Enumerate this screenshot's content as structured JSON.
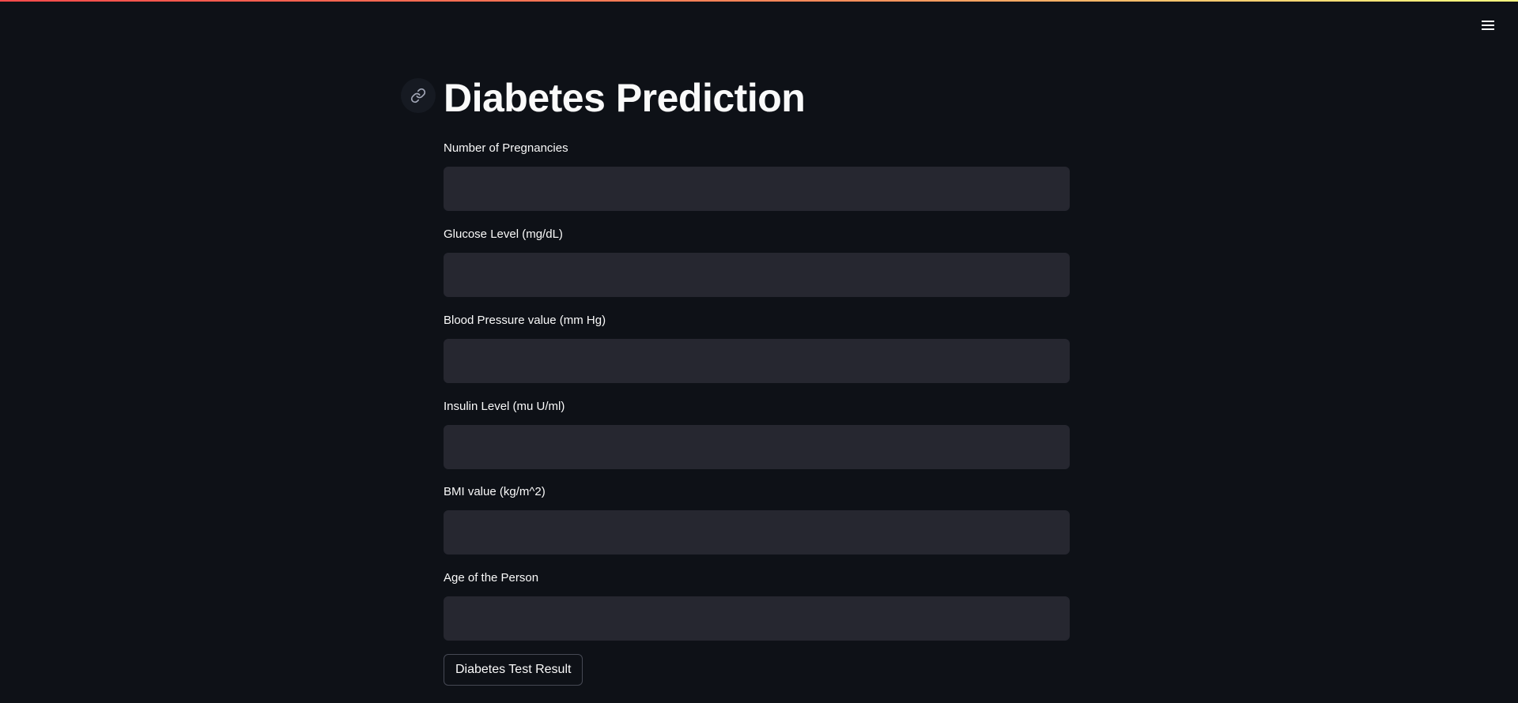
{
  "header": {
    "menu_icon": "hamburger-menu-icon"
  },
  "main": {
    "title": "Diabetes Prediction",
    "anchor_icon": "link-icon",
    "fields": [
      {
        "label": "Number of Pregnancies",
        "value": "",
        "placeholder": ""
      },
      {
        "label": "Glucose Level (mg/dL)",
        "value": "",
        "placeholder": ""
      },
      {
        "label": "Blood Pressure value (mm Hg)",
        "value": "",
        "placeholder": ""
      },
      {
        "label": "Insulin Level (mu U/ml)",
        "value": "",
        "placeholder": ""
      },
      {
        "label": "BMI value (kg/m^2)",
        "value": "",
        "placeholder": ""
      },
      {
        "label": "Age of the Person",
        "value": "",
        "placeholder": ""
      }
    ],
    "submit_label": "Diabetes Test Result"
  },
  "colors": {
    "background": "#0e1117",
    "input_background": "#262730",
    "text": "#fafafa",
    "accent_start": "#ff4b4b",
    "accent_end": "#fffd80"
  }
}
